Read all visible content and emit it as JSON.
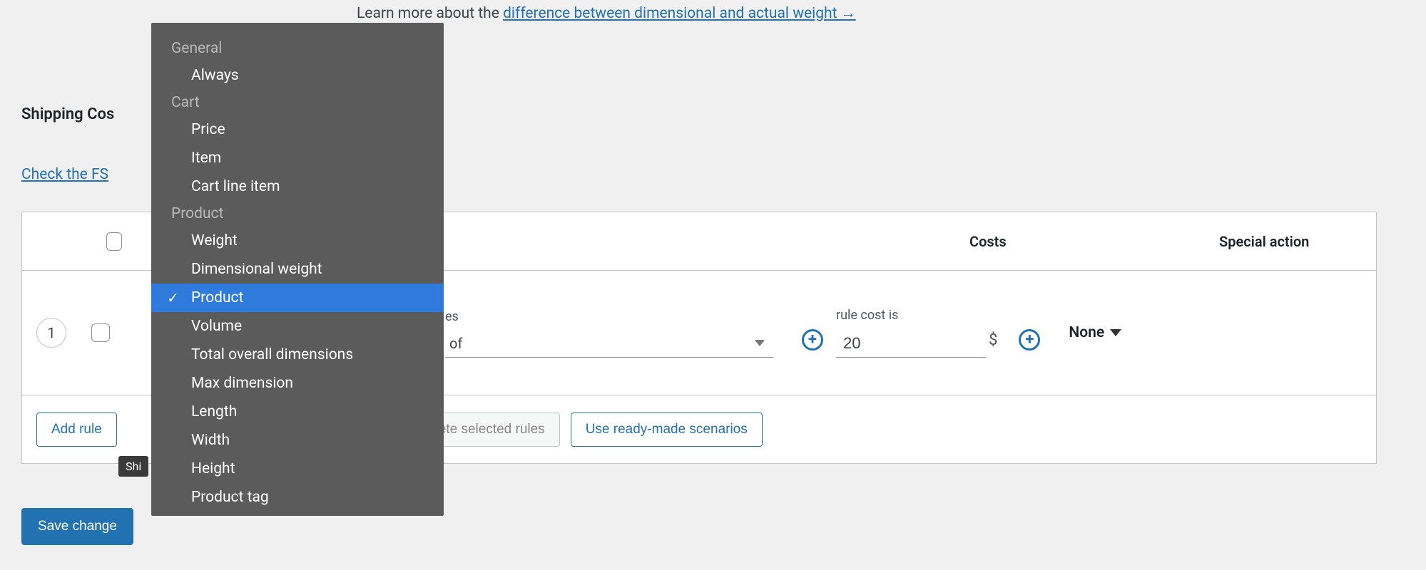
{
  "learn_more": {
    "prefix": "Learn more about the ",
    "link_text": "difference between dimensional and actual weight →"
  },
  "section_title": "Shipping Cos",
  "check_fs": "Check the FS",
  "table": {
    "head": {
      "costs": "Costs",
      "special": "Special action"
    },
    "row": {
      "num": "1",
      "of_label_fragment": "es",
      "of_text": "of",
      "cost_label": "rule cost is",
      "cost_value": "20",
      "currency": "$",
      "special_value": "None"
    },
    "foot": {
      "add_rule": "Add rule",
      "delete_fragment": "ete selected rules",
      "scenarios": "Use ready-made scenarios"
    }
  },
  "tooltip": "Shi",
  "save": "Save change",
  "dropdown": {
    "groups": [
      {
        "label": "General",
        "items": [
          "Always"
        ]
      },
      {
        "label": "Cart",
        "items": [
          "Price",
          "Item",
          "Cart line item"
        ]
      },
      {
        "label": "Product",
        "items": [
          "Weight",
          "Dimensional weight",
          "Product",
          "Volume",
          "Total overall dimensions",
          "Max dimension",
          "Length",
          "Width",
          "Height",
          "Product tag"
        ]
      }
    ],
    "selected": "Product"
  }
}
